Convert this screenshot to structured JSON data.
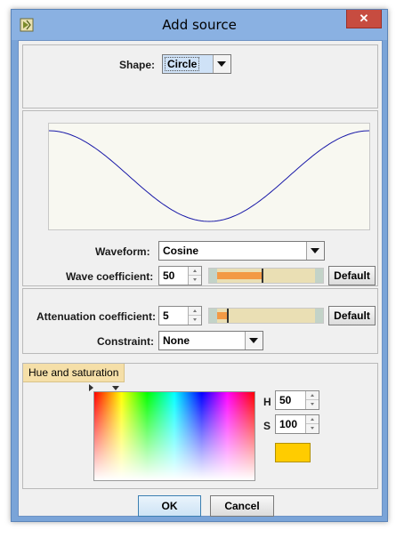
{
  "window": {
    "title": "Add source",
    "close_glyph": "✕",
    "app_icon": "app-icon",
    "close_icon": "close-icon"
  },
  "shape": {
    "label": "Shape:",
    "value": "Circle"
  },
  "wave": {
    "waveform_label": "Waveform:",
    "waveform_value": "Cosine",
    "coef_label": "Wave coefficient:",
    "coef_value": "50",
    "coef_slider_fraction": 0.45,
    "default_label": "Default"
  },
  "attenuation": {
    "label": "Attenuation coefficient:",
    "value": "5",
    "slider_fraction": 0.1,
    "default_label": "Default",
    "constraint_label": "Constraint:",
    "constraint_value": "None"
  },
  "hue": {
    "tab_label": "Hue and saturation",
    "h_label": "H",
    "h_value": "50",
    "s_label": "S",
    "s_value": "100",
    "swatch_color": "#ffcc00"
  },
  "buttons": {
    "ok": "OK",
    "cancel": "Cancel"
  },
  "colors": {
    "wave_line": "#1a1aa8",
    "slider_fill": "#f39a45",
    "titlebar": "#8ab1e2"
  }
}
